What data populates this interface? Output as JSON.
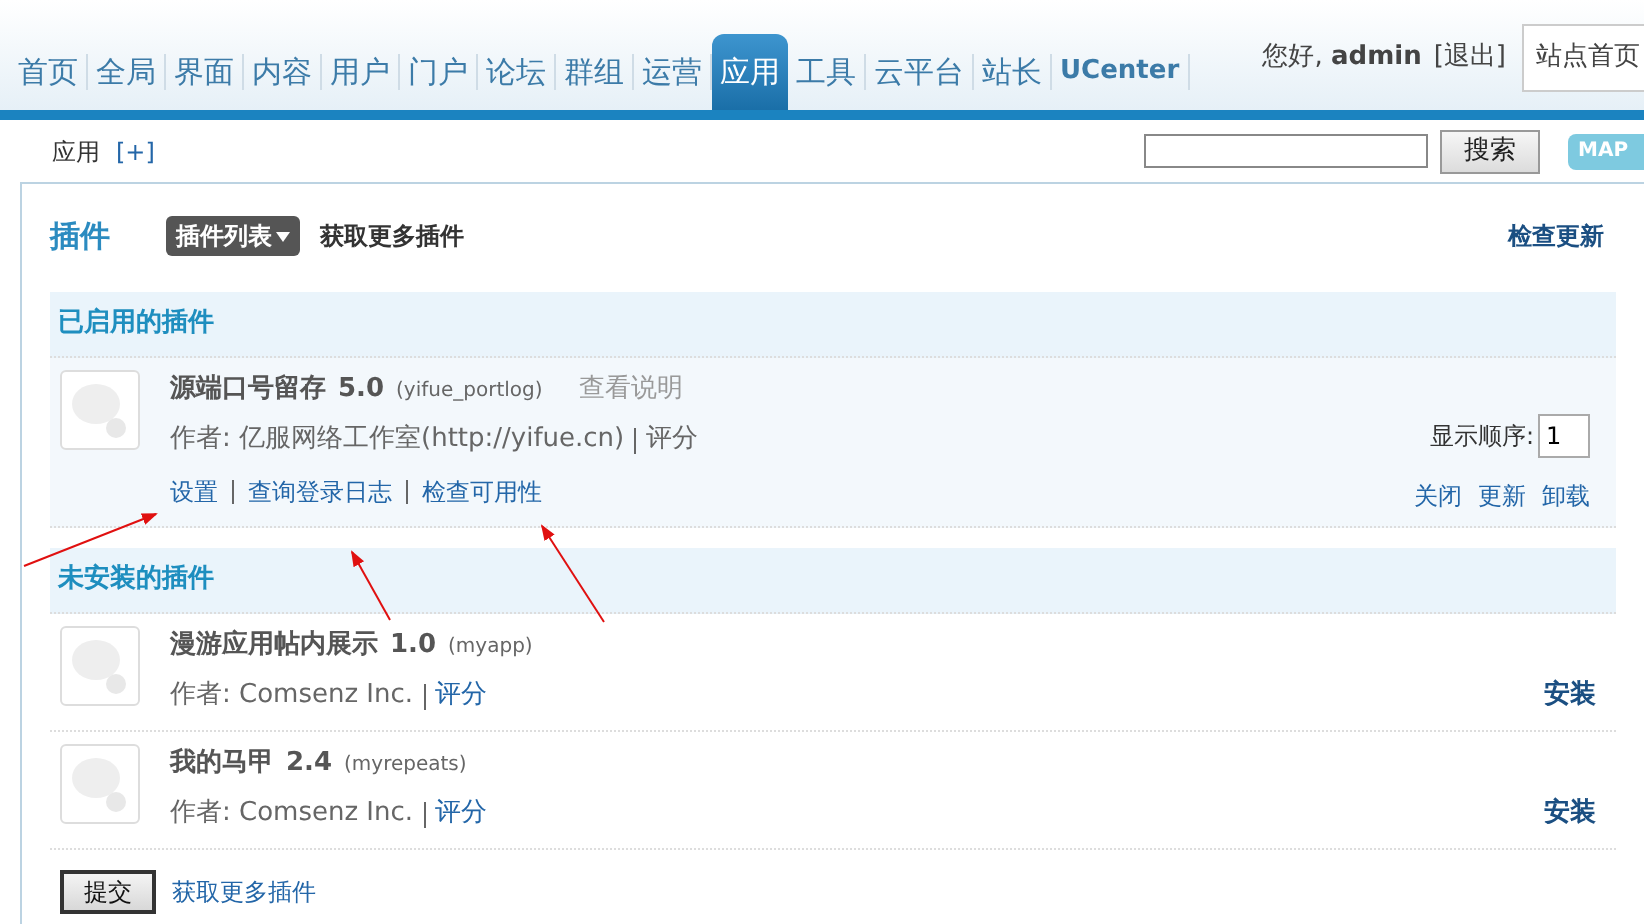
{
  "nav": {
    "tabs": [
      {
        "label": "首页",
        "selected": false
      },
      {
        "label": "全局",
        "selected": false
      },
      {
        "label": "界面",
        "selected": false
      },
      {
        "label": "内容",
        "selected": false
      },
      {
        "label": "用户",
        "selected": false
      },
      {
        "label": "门户",
        "selected": false
      },
      {
        "label": "论坛",
        "selected": false
      },
      {
        "label": "群组",
        "selected": false
      },
      {
        "label": "运营",
        "selected": false
      },
      {
        "label": "应用",
        "selected": true
      },
      {
        "label": "工具",
        "selected": false
      },
      {
        "label": "云平台",
        "selected": false
      },
      {
        "label": "站长",
        "selected": false
      },
      {
        "label": "UCenter",
        "selected": false
      }
    ],
    "greeting": "您好,",
    "user": "admin",
    "logout": "[退出]",
    "site_select": "站点首页"
  },
  "subnav": {
    "label": "应用",
    "add": "[+]",
    "search_button": "搜索",
    "map": "MAP"
  },
  "page": {
    "title": "插件",
    "dropdown": "插件列表",
    "more_link": "获取更多插件",
    "check_updates": "检查更新"
  },
  "sections": [
    {
      "title": "已启用的插件",
      "plugins": [
        {
          "kind": "enabled",
          "name": "源端口号留存",
          "version": "5.0",
          "id": "(yifue_portlog)",
          "doc": "查看说明",
          "author": "作者: 亿服网络工作室(http://yifue.cn)",
          "rating": "评分",
          "links": [
            "设置",
            "查询登录日志",
            "检查可用性"
          ],
          "order_label": "显示顺序:",
          "order": "1",
          "actions": [
            "关闭",
            "更新",
            "卸载"
          ]
        }
      ]
    },
    {
      "title": "未安装的插件",
      "plugins": [
        {
          "kind": "uninstalled",
          "name": "漫游应用帖内展示",
          "version": "1.0",
          "id": "(myapp)",
          "author": "作者: Comsenz Inc.",
          "rating": "评分",
          "actions": [
            "安装"
          ]
        },
        {
          "kind": "uninstalled",
          "name": "我的马甲",
          "version": "2.4",
          "id": "(myrepeats)",
          "author": "作者: Comsenz Inc.",
          "rating": "评分",
          "actions": [
            "安装"
          ]
        }
      ]
    }
  ],
  "footer": {
    "submit": "提交",
    "more_link": "获取更多插件"
  }
}
